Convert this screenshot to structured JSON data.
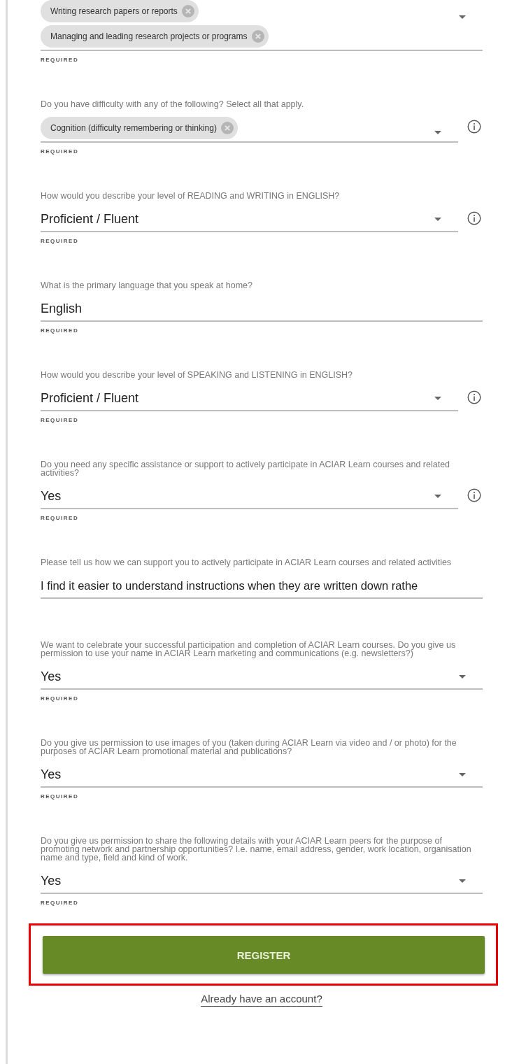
{
  "fields": [
    {
      "kind": "chips",
      "chips": [
        "Writing research papers or reports",
        "Managing and leading research projects or programs"
      ],
      "info": false,
      "dropdown": true,
      "hint": "REQUIRED"
    },
    {
      "kind": "chips",
      "label": "Do you have difficulty with any of the following? Select all that apply.",
      "chips": [
        "Cognition (difficulty remembering or thinking)"
      ],
      "info": true,
      "dropdown": true,
      "hint": "REQUIRED"
    },
    {
      "kind": "select",
      "label": "How would you describe your level of READING and WRITING in ENGLISH?",
      "value": "Proficient / Fluent",
      "info": true,
      "dropdown": true,
      "hint": "REQUIRED"
    },
    {
      "kind": "text",
      "label": "What is the primary language that you speak at home?",
      "value": "English",
      "info": false,
      "dropdown": false,
      "hint": "REQUIRED"
    },
    {
      "kind": "select",
      "label": "How would you describe your level of SPEAKING and LISTENING in ENGLISH?",
      "value": "Proficient / Fluent",
      "info": true,
      "dropdown": true,
      "hint": "REQUIRED"
    },
    {
      "kind": "select",
      "label": "Do you need any specific assistance or support to actively participate in ACIAR Learn courses and related activities?",
      "value": "Yes",
      "info": true,
      "dropdown": true,
      "hint": "REQUIRED"
    },
    {
      "kind": "longtext",
      "label": "Please tell us how we can support you to actively participate in ACIAR Learn courses and related activities",
      "value": "I find it easier to understand instructions when they are written down rathe",
      "info": false,
      "dropdown": false
    },
    {
      "kind": "select",
      "label": "We want to celebrate your successful participation and completion of ACIAR Learn courses. Do you give us permission to use your name in ACIAR Learn marketing and communications (e.g. newsletters?)",
      "value": "Yes",
      "info": false,
      "dropdown": true,
      "hint": "REQUIRED"
    },
    {
      "kind": "select",
      "label": "Do you give us permission to use images of you (taken during ACIAR Learn via video and / or photo) for the purposes of ACIAR Learn promotional material and publications?",
      "value": "Yes",
      "info": false,
      "dropdown": true,
      "hint": "REQUIRED"
    },
    {
      "kind": "select",
      "label": "Do you give us permission to share the following details with your ACIAR Learn peers for the purpose of promoting network and partnership opportunities? I.e. name, email address, gender, work location, organisation name and type, field and kind of work.",
      "value": "Yes",
      "info": false,
      "dropdown": true,
      "hint": "REQUIRED"
    }
  ],
  "register": {
    "label": "REGISTER",
    "highlighted": true
  },
  "login_link": "Already have an account?"
}
